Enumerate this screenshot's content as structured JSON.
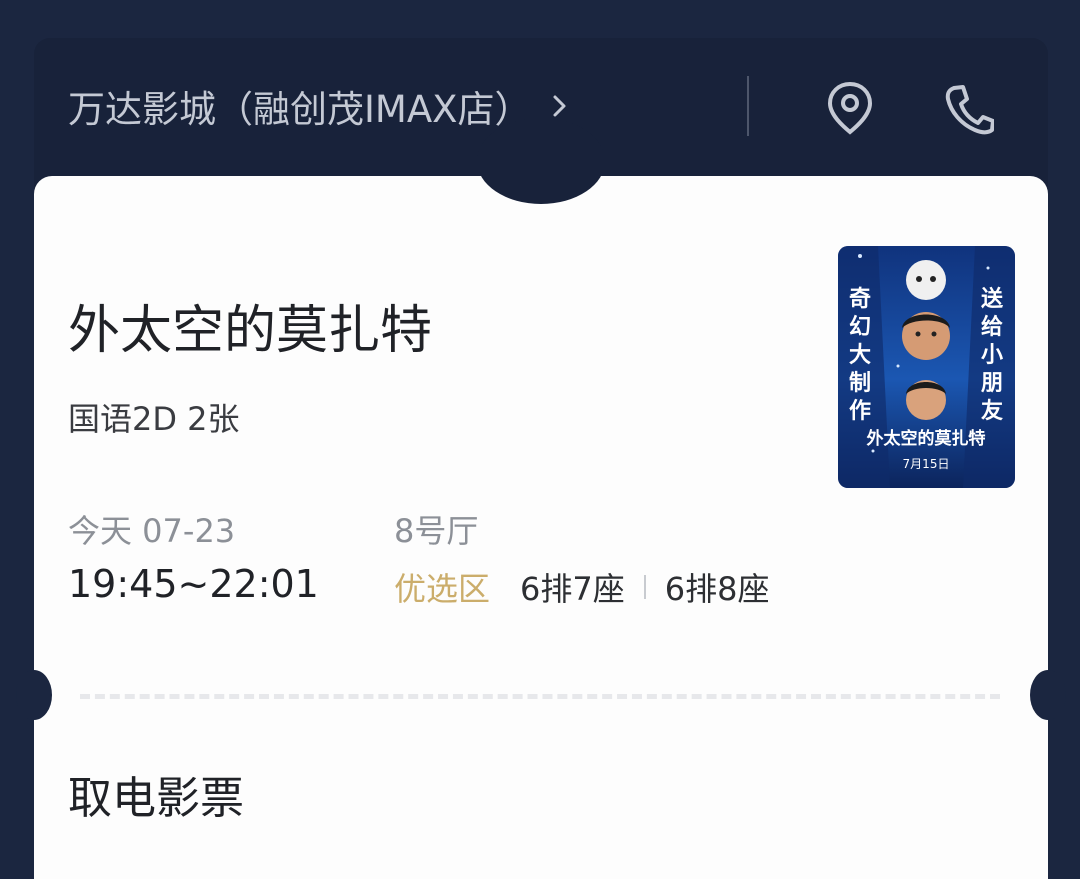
{
  "header": {
    "cinema_name": "万达影城（融创茂IMAX店）",
    "chevron": "chevron-right-icon",
    "location_icon": "map-pin-icon",
    "phone_icon": "phone-icon"
  },
  "movie": {
    "title": "外太空的莫扎特",
    "meta": "国语2D 2张",
    "date": "今天 07-23",
    "time": "19:45~22:01",
    "hall": "8号厅",
    "zone": "优选区",
    "seats": [
      "6排7座",
      "6排8座"
    ]
  },
  "poster": {
    "left_text": [
      "奇",
      "幻",
      "大",
      "制",
      "作"
    ],
    "right_text": [
      "送",
      "给",
      "小",
      "朋",
      "友"
    ],
    "title_text": "外太空的莫扎特",
    "date_text": "7月15日"
  },
  "section": {
    "title": "取电影票"
  },
  "colors": {
    "background": "#1b2640",
    "card": "#fdfdfd",
    "zone_gold": "#cbad6b",
    "poster_blue": "#1947a0"
  }
}
